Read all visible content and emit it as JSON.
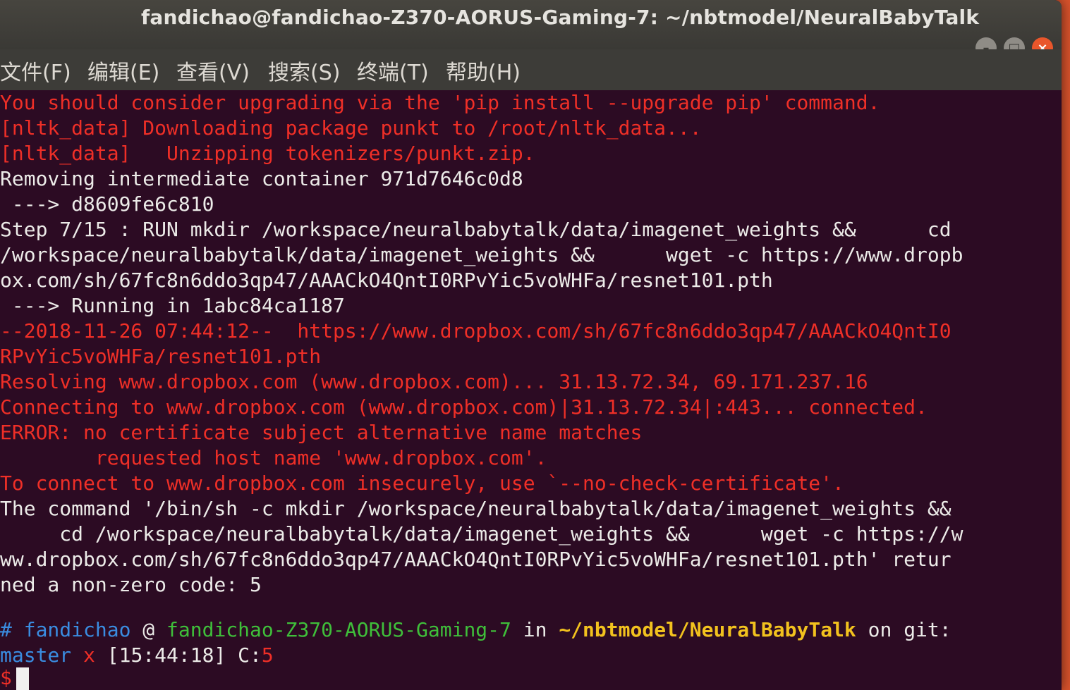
{
  "window": {
    "title": "fandichao@fandichao-Z370-AORUS-Gaming-7: ~/nbtmodel/NeuralBabyTalk",
    "controls": {
      "minimize": "–",
      "maximize": "□",
      "close": "×"
    }
  },
  "menu": [
    {
      "label": "文件(F)"
    },
    {
      "label": "编辑(E)"
    },
    {
      "label": "查看(V)"
    },
    {
      "label": "搜索(S)"
    },
    {
      "label": "终端(T)"
    },
    {
      "label": "帮助(H)"
    }
  ],
  "terminal": {
    "lines": [
      {
        "text": "You should consider upgrading via the 'pip install --upgrade pip' command.",
        "color": "red"
      },
      {
        "text": "[nltk_data] Downloading package punkt to /root/nltk_data...",
        "color": "red"
      },
      {
        "text": "[nltk_data]   Unzipping tokenizers/punkt.zip.",
        "color": "red"
      },
      {
        "text": "Removing intermediate container 971d7646c0d8",
        "color": "white"
      },
      {
        "text": " ---> d8609fe6c810",
        "color": "white"
      },
      {
        "text": "Step 7/15 : RUN mkdir /workspace/neuralbabytalk/data/imagenet_weights &&      cd",
        "color": "white"
      },
      {
        "text": "/workspace/neuralbabytalk/data/imagenet_weights &&      wget -c https://www.dropb",
        "color": "white"
      },
      {
        "text": "ox.com/sh/67fc8n6ddo3qp47/AAACkO4QntI0RPvYic5voWHFa/resnet101.pth",
        "color": "white"
      },
      {
        "text": " ---> Running in 1abc84ca1187",
        "color": "white"
      },
      {
        "text": "--2018-11-26 07:44:12--  https://www.dropbox.com/sh/67fc8n6ddo3qp47/AAACkO4QntI0",
        "color": "red"
      },
      {
        "text": "RPvYic5voWHFa/resnet101.pth",
        "color": "red"
      },
      {
        "text": "Resolving www.dropbox.com (www.dropbox.com)... 31.13.72.34, 69.171.237.16",
        "color": "red"
      },
      {
        "text": "Connecting to www.dropbox.com (www.dropbox.com)|31.13.72.34|:443... connected.",
        "color": "red"
      },
      {
        "text": "ERROR: no certificate subject alternative name matches",
        "color": "red"
      },
      {
        "text": "        requested host name 'www.dropbox.com'.",
        "color": "red"
      },
      {
        "text": "To connect to www.dropbox.com insecurely, use `--no-check-certificate'.",
        "color": "red"
      },
      {
        "text": "The command '/bin/sh -c mkdir /workspace/neuralbabytalk/data/imagenet_weights &&",
        "color": "white"
      },
      {
        "text": "     cd /workspace/neuralbabytalk/data/imagenet_weights &&      wget -c https://w",
        "color": "white"
      },
      {
        "text": "ww.dropbox.com/sh/67fc8n6ddo3qp47/AAACkO4QntI0RPvYic5voWHFa/resnet101.pth' retur",
        "color": "white"
      },
      {
        "text": "ned a non-zero code: 5",
        "color": "white"
      }
    ],
    "prompt": {
      "hash": "#",
      "user": "fandichao",
      "at": "@",
      "host": "fandichao-Z370-AORUS-Gaming-7",
      "in": "in",
      "path": "~/nbtmodel/NeuralBabyTalk",
      "on_git": "on git:",
      "branch": "master",
      "dirty": "x",
      "time": "[15:44:18]",
      "code_label": "C:",
      "code": "5",
      "dollar": "$"
    },
    "colors": {
      "red": "#ef2f27",
      "white": "#ecebe8",
      "blue": "#3a8ce0",
      "green": "#3fbf3a",
      "yellow": "#f2c21e",
      "background": "#2c0b23"
    }
  }
}
